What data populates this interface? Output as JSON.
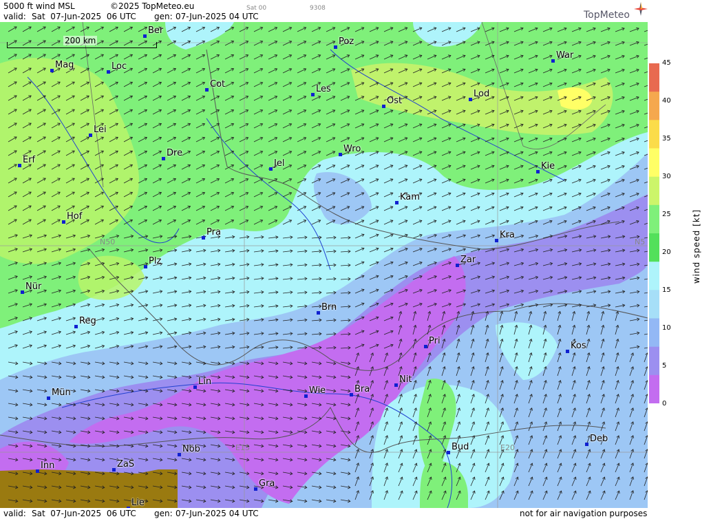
{
  "header": {
    "product": "5000 ft wind MSL",
    "copyright": "©2025 TopMeteo.eu",
    "valid_label": "valid:",
    "valid_value": "Sat  07-Jun-2025  06 UTC",
    "gen_label": "gen:",
    "gen_value": "07-Jun-2025 04 UTC",
    "run_tag": "Sat 00",
    "code": "9308",
    "logo": "TopMeteo"
  },
  "footer": {
    "valid_label": "valid:",
    "valid_value": "Sat  07-Jun-2025  06 UTC",
    "gen_label": "gen:",
    "gen_value": "07-Jun-2025 04 UTC",
    "notice": "not for air navigation purposes"
  },
  "scale": {
    "label": "200 km"
  },
  "grid_labels": {
    "n50_left": "N50",
    "n50_right": "N5",
    "e15": "E15",
    "e20": "E20"
  },
  "cities": [
    {
      "name": "Ber"
    },
    {
      "name": "Poz"
    },
    {
      "name": "War"
    },
    {
      "name": "Mag"
    },
    {
      "name": "Loc"
    },
    {
      "name": "Cot"
    },
    {
      "name": "Les"
    },
    {
      "name": "Ost"
    },
    {
      "name": "Lod"
    },
    {
      "name": "Lei"
    },
    {
      "name": "Erf"
    },
    {
      "name": "Dre"
    },
    {
      "name": "Jel"
    },
    {
      "name": "Wro"
    },
    {
      "name": "Kie"
    },
    {
      "name": "Kam"
    },
    {
      "name": "Hof"
    },
    {
      "name": "Pra"
    },
    {
      "name": "Kra"
    },
    {
      "name": "Plz"
    },
    {
      "name": "Zar"
    },
    {
      "name": "Nür"
    },
    {
      "name": "Brn"
    },
    {
      "name": "Reg"
    },
    {
      "name": "Pri"
    },
    {
      "name": "Kos"
    },
    {
      "name": "Lin"
    },
    {
      "name": "Nit"
    },
    {
      "name": "Wie"
    },
    {
      "name": "Bra"
    },
    {
      "name": "Mün"
    },
    {
      "name": "Bud"
    },
    {
      "name": "Deb"
    },
    {
      "name": "Nöb"
    },
    {
      "name": "Inn"
    },
    {
      "name": "ZaS"
    },
    {
      "name": "Gra"
    },
    {
      "name": "Lie"
    }
  ],
  "legend": {
    "title": "wind  speed  [kt]",
    "ticks": [
      "45",
      "40",
      "35",
      "30",
      "25",
      "20",
      "15",
      "10",
      "5",
      "0"
    ],
    "colors": [
      "#e86a50",
      "#f5a84e",
      "#fbdc4a",
      "#ffff66",
      "#ccf56a",
      "#7ff07a",
      "#53e05b",
      "#aef4fb",
      "#a6dff8",
      "#93b8f5",
      "#9c8ff0",
      "#c36df0"
    ]
  },
  "map_colors": {
    "green": "#7ff07a",
    "light_green": "#b9f56a",
    "yellow_green": "#d8f06a",
    "cyan": "#aef4fb",
    "light_blue": "#9dc7f5",
    "violet": "#9c8ff0",
    "purple": "#c36df0",
    "terrain_brown": "#9a7a10"
  }
}
